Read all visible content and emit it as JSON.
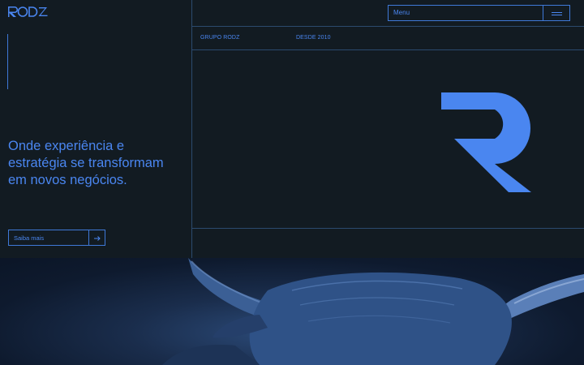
{
  "brand": {
    "logo_text": "RODZ",
    "accent_color": "#4a86f0",
    "background_color": "#121b22"
  },
  "nav": {
    "menu_label": "Menu",
    "menu_icon": "hamburger-icon"
  },
  "meta": {
    "group_label": "GRUPO RODZ",
    "since_label": "DESDE 2010"
  },
  "hero": {
    "headline_lines": [
      "Onde experiência e",
      "estratégia se transformam",
      "em novos negócios."
    ],
    "cta_label": "Saiba mais",
    "cta_icon": "arrow-right-icon",
    "mark_icon": "rodz-r-mark-icon"
  },
  "photo": {
    "subject": "bull-photo"
  }
}
